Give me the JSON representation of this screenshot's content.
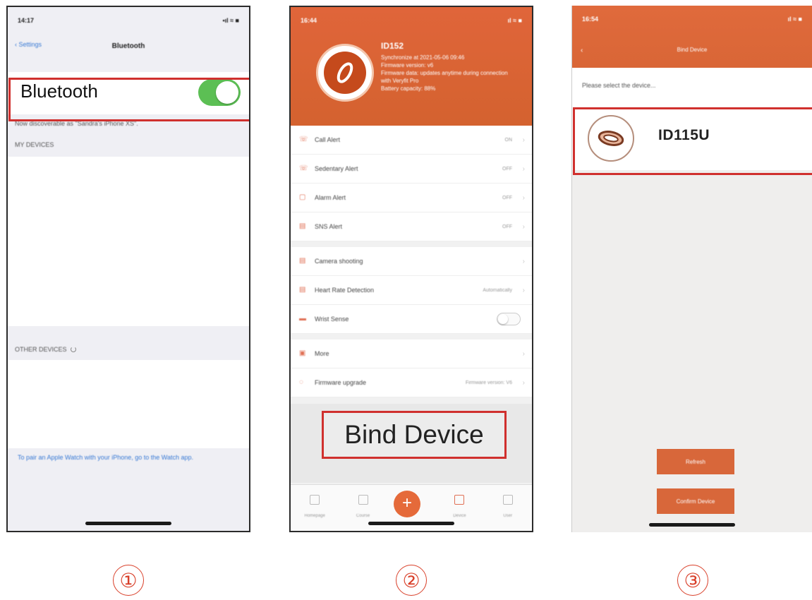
{
  "phone1": {
    "status_time": "14:17",
    "status_icons": "•ıl ≈ ■",
    "nav_back": "Settings",
    "nav_title": "Bluetooth",
    "bluetooth_label": "Bluetooth",
    "bluetooth_on": true,
    "note": "Now discoverable as \"Sandra's iPhone XS\".",
    "my_devices_header": "MY DEVICES",
    "other_devices_header": "OTHER DEVICES",
    "footer_text": "To pair an Apple Watch with your iPhone, go to the Watch app."
  },
  "phone2": {
    "status_time": "16:44",
    "status_icons": "ıl ≈ ■",
    "device_name": "ID152",
    "info_lines": [
      "Synchronize at 2021-05-06 09:46",
      "Firmware version: v6",
      "Firmware data: updates anytime during connection",
      "with Veryfit Pro",
      "Battery capacity: 88%"
    ],
    "menu_groups": [
      [
        {
          "icon": "phone-icon",
          "glyph": "☏",
          "label": "Call Alert",
          "value": "ON"
        },
        {
          "icon": "sedentary-icon",
          "glyph": "☏",
          "label": "Sedentary Alert",
          "value": "OFF"
        },
        {
          "icon": "alarm-icon",
          "glyph": "▢",
          "label": "Alarm Alert",
          "value": "OFF"
        },
        {
          "icon": "sns-icon",
          "glyph": "▤",
          "label": "SNS Alert",
          "value": "OFF"
        }
      ],
      [
        {
          "icon": "camera-icon",
          "glyph": "▤",
          "label": "Camera shooting",
          "value": ""
        },
        {
          "icon": "heart-rate-icon",
          "glyph": "▤",
          "label": "Heart Rate Detection",
          "value": "Automatically"
        },
        {
          "icon": "wrist-icon",
          "glyph": "▬",
          "label": "Wrist Sense",
          "value": "",
          "toggle": true
        }
      ],
      [
        {
          "icon": "more-icon",
          "glyph": "▣",
          "label": "More",
          "value": ""
        },
        {
          "icon": "firmware-icon",
          "glyph": "◌",
          "label": "Firmware upgrade",
          "value": "Firmware version: V6"
        }
      ]
    ],
    "bind_label": "Bind Device",
    "tabs": [
      {
        "icon": "home-icon",
        "label": "Homepage"
      },
      {
        "icon": "chart-icon",
        "label": "Course"
      },
      {
        "icon": "add-icon",
        "label": "+"
      },
      {
        "icon": "device-icon",
        "label": "Device"
      },
      {
        "icon": "user-icon",
        "label": "User"
      }
    ]
  },
  "phone3": {
    "status_time": "16:54",
    "status_icons": "ıl ≈ ■",
    "nav_back": "‹",
    "nav_title": "Bind Device",
    "prompt": "Please select the device...",
    "device_name": "ID115U",
    "refresh_label": "Refresh",
    "confirm_label": "Confirm Device"
  },
  "steps": [
    "①",
    "②",
    "③"
  ],
  "colors": {
    "highlight_red": "#d0302e",
    "brand_orange": "#e0653a",
    "toggle_green": "#5cbf54",
    "step_red": "#d9402a"
  }
}
